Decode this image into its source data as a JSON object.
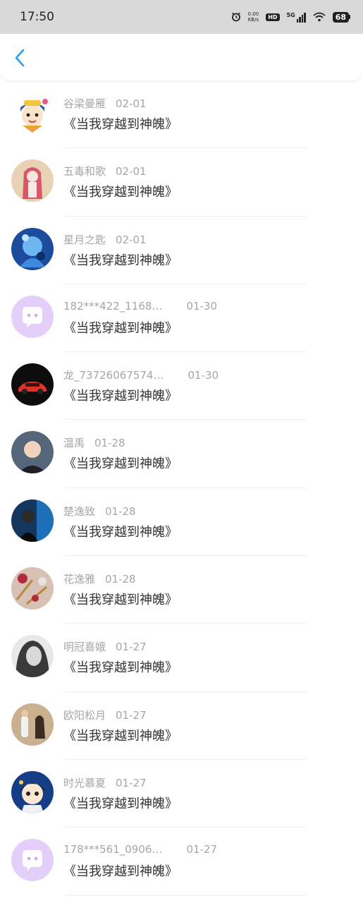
{
  "status_bar": {
    "time": "17:50",
    "speed_value": "0.00",
    "speed_unit": "KB/s",
    "hd": "HD",
    "network": "5G",
    "battery": "68"
  },
  "header": {
    "back_icon": "chevron-left-icon",
    "accent_color": "#2b9cf2"
  },
  "items": [
    {
      "name": "谷梁曼雁",
      "date": "02-01",
      "title": "《当我穿越到神魄》",
      "avatar": "cartoon-character"
    },
    {
      "name": "五毒和歌",
      "date": "02-01",
      "title": "《当我穿越到神魄》",
      "avatar": "anime-girl-pink-hair"
    },
    {
      "name": "星月之匙",
      "date": "02-01",
      "title": "《当我穿越到神魄》",
      "avatar": "blue-crystal-figure"
    },
    {
      "name": "182***422_1168…",
      "date": "01-30",
      "title": "《当我穿越到神魄》",
      "avatar": "default-chat-bubble"
    },
    {
      "name": "龙_73726067574…",
      "date": "01-30",
      "title": "《当我穿越到神魄》",
      "avatar": "red-sports-car"
    },
    {
      "name": "温禹",
      "date": "01-28",
      "title": "《当我穿越到神魄》",
      "avatar": "man-portrait"
    },
    {
      "name": "楚逸致",
      "date": "01-28",
      "title": "《当我穿越到神魄》",
      "avatar": "blue-dark-figure"
    },
    {
      "name": "花逸雅",
      "date": "01-28",
      "title": "《当我穿越到神魄》",
      "avatar": "hair-clips"
    },
    {
      "name": "明冠喜娥",
      "date": "01-27",
      "title": "《当我穿越到神魄》",
      "avatar": "grayscale-woman"
    },
    {
      "name": "欧阳松月",
      "date": "01-27",
      "title": "《当我穿越到神魄》",
      "avatar": "person-with-dog"
    },
    {
      "name": "时光慕夏",
      "date": "01-27",
      "title": "《当我穿越到神魄》",
      "avatar": "cartoon-girl"
    },
    {
      "name": "178***561_0906…",
      "date": "01-27",
      "title": "《当我穿越到神魄》",
      "avatar": "default-chat-bubble"
    }
  ]
}
